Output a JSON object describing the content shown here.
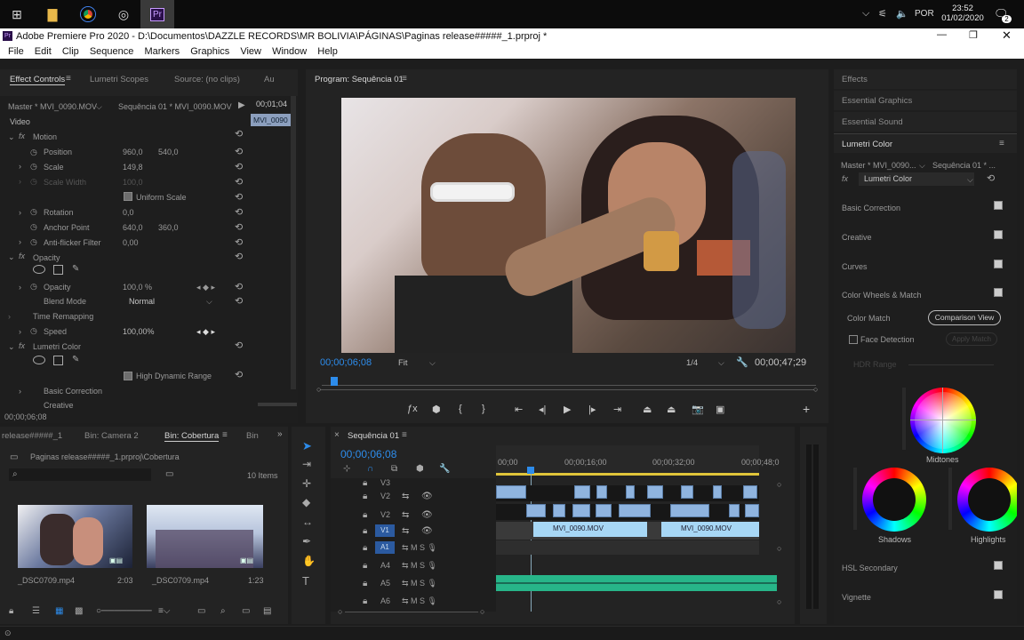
{
  "taskbar": {
    "time": "23:52",
    "date": "01/02/2020",
    "lang": "POR",
    "notif_count": "2"
  },
  "window": {
    "title": "Adobe Premiere Pro 2020 - D:\\Documentos\\DAZZLE RECORDS\\MR BOLIVIA\\PÁGINAS\\Paginas release#####_1.prproj *",
    "app_icon": "Pr"
  },
  "menu": [
    "File",
    "Edit",
    "Clip",
    "Sequence",
    "Markers",
    "Graphics",
    "View",
    "Window",
    "Help"
  ],
  "effect_controls": {
    "tabs": [
      "Effect Controls",
      "Lumetri Scopes",
      "Source: (no clips)",
      "Au"
    ],
    "master": "Master * MVI_0090.MOV",
    "sequence": "Sequência 01 * MVI_0090.MOV",
    "timecode_top": "00;01;04",
    "clip_label": "MVI_0090",
    "video_label": "Video",
    "motion": "Motion",
    "position_label": "Position",
    "position_x": "960,0",
    "position_y": "540,0",
    "scale_label": "Scale",
    "scale": "149,8",
    "scale_width_label": "Scale Width",
    "scale_width": "100,0",
    "uniform_scale": "Uniform Scale",
    "rotation_label": "Rotation",
    "rotation": "0,0",
    "anchor_label": "Anchor Point",
    "anchor_x": "640,0",
    "anchor_y": "360,0",
    "antiflicker_label": "Anti-flicker Filter",
    "antiflicker": "0,00",
    "opacity_section": "Opacity",
    "opacity_label": "Opacity",
    "opacity": "100,0 %",
    "blend_label": "Blend Mode",
    "blend": "Normal",
    "time_remap": "Time Remapping",
    "speed_label": "Speed",
    "speed": "100,00%",
    "lumetri": "Lumetri Color",
    "hdr": "High Dynamic Range",
    "basic_correction": "Basic Correction",
    "creative": "Creative",
    "bottom_time": "00;00;06;08"
  },
  "program": {
    "tab": "Program: Sequência 01",
    "timecode": "00;00;06;08",
    "fit": "Fit",
    "quality": "1/4",
    "duration": "00;00;47;29"
  },
  "project": {
    "tabs": [
      "release#####_1",
      "Bin: Camera 2",
      "Bin: Cobertura",
      "Bin"
    ],
    "path": "Paginas release#####_1.prproj\\Cobertura",
    "items_count": "10 Items",
    "clips": [
      {
        "name": "_DSC0709.mp4",
        "duration": "2:03"
      },
      {
        "name": "_DSC0709.mp4",
        "duration": "1:23"
      }
    ]
  },
  "timeline": {
    "tab": "Sequência 01",
    "timecode": "00;00;06;08",
    "ruler": [
      "00;00",
      "00;00;16;00",
      "00;00;32;00",
      "00;00;48;0"
    ],
    "tracks": [
      "V3",
      "V2",
      "V1",
      "A1",
      "A4",
      "A5",
      "A6"
    ],
    "clip_label": "MVI_0090.MOV"
  },
  "right_panel": {
    "tabs": [
      "Effects",
      "Essential Graphics",
      "Essential Sound"
    ],
    "lumetri_title": "Lumetri Color",
    "master": "Master * MVI_0090...",
    "sequence": "Sequência 01 * ...",
    "fx": "Lumetri Color",
    "sections": [
      "Basic Correction",
      "Creative",
      "Curves",
      "Color Wheels & Match"
    ],
    "color_match": "Color Match",
    "comparison_view": "Comparison View",
    "face_detection": "Face Detection",
    "apply_match": "Apply Match",
    "hdr_range": "HDR Range",
    "midtones": "Midtones",
    "shadows": "Shadows",
    "highlights": "Highlights",
    "hsl": "HSL Secondary",
    "vignette": "Vignette"
  }
}
